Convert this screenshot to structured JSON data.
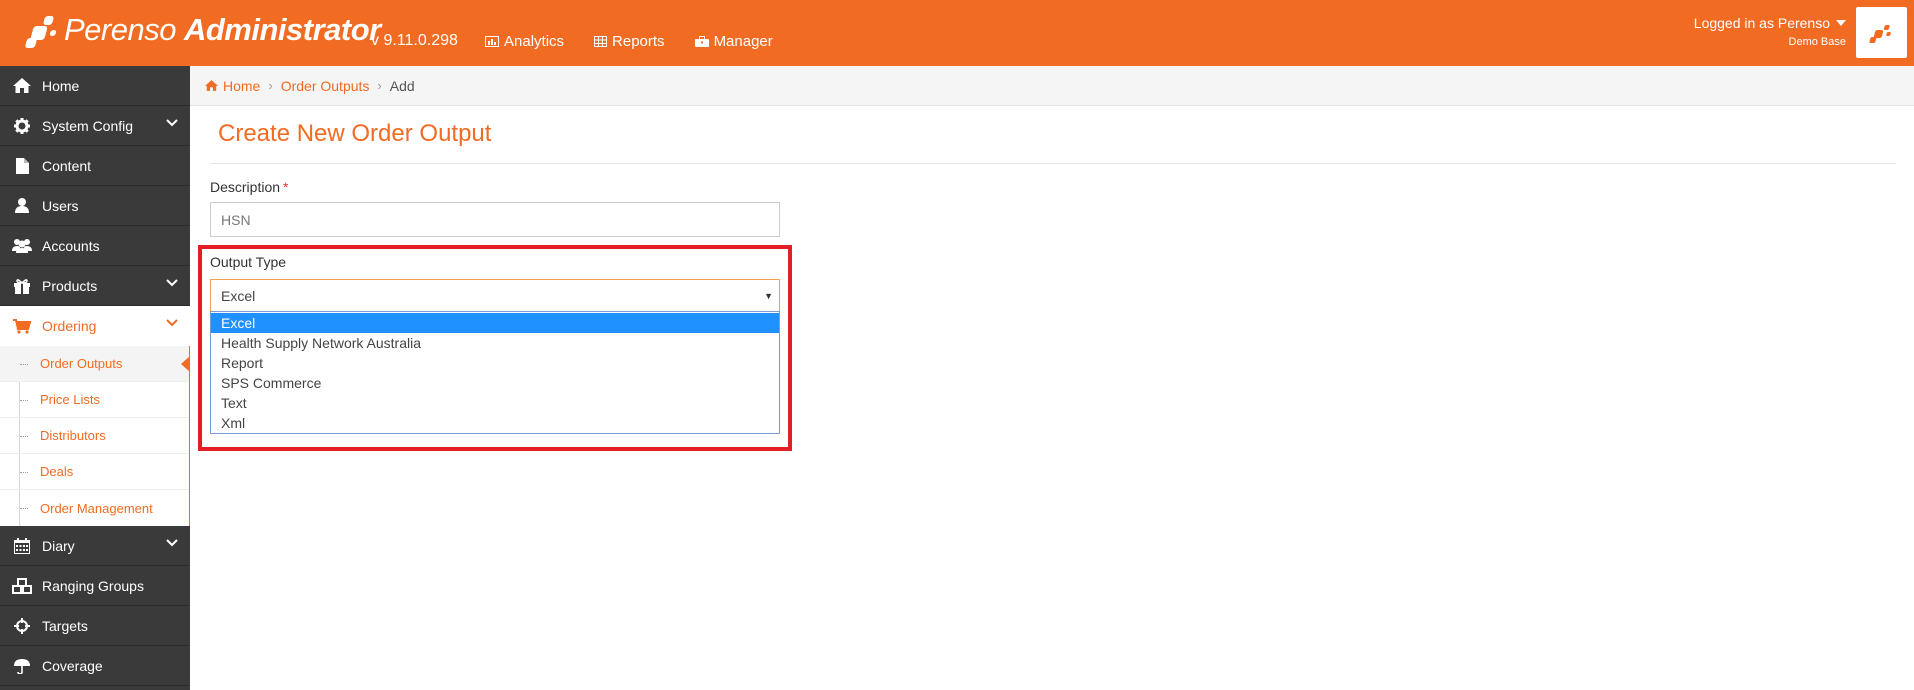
{
  "header": {
    "brand_light": "Perenso",
    "brand_bold": "Administrator",
    "version": "v 9.11.0.298",
    "nav": [
      {
        "label": "Analytics",
        "icon": "chart-icon"
      },
      {
        "label": "Reports",
        "icon": "table-icon"
      },
      {
        "label": "Manager",
        "icon": "briefcase-icon"
      }
    ],
    "user": {
      "logged_in": "Logged in as Perenso",
      "base": "Demo Base"
    },
    "accent_color": "#f26b22"
  },
  "sidebar": {
    "items": [
      {
        "label": "Home",
        "icon": "home-icon",
        "expandable": false
      },
      {
        "label": "System Config",
        "icon": "gear-icon",
        "expandable": true
      },
      {
        "label": "Content",
        "icon": "file-icon",
        "expandable": false
      },
      {
        "label": "Users",
        "icon": "user-icon",
        "expandable": false
      },
      {
        "label": "Accounts",
        "icon": "users-icon",
        "expandable": false
      },
      {
        "label": "Products",
        "icon": "gift-icon",
        "expandable": true
      },
      {
        "label": "Ordering",
        "icon": "cart-icon",
        "expandable": true,
        "active": true
      }
    ],
    "ordering_sub": [
      {
        "label": "Order Outputs",
        "current": true
      },
      {
        "label": "Price Lists"
      },
      {
        "label": "Distributors"
      },
      {
        "label": "Deals"
      },
      {
        "label": "Order Management"
      }
    ],
    "items_after": [
      {
        "label": "Diary",
        "icon": "calendar-icon",
        "expandable": true
      },
      {
        "label": "Ranging Groups",
        "icon": "cubes-icon",
        "expandable": false
      },
      {
        "label": "Targets",
        "icon": "crosshair-icon",
        "expandable": false
      },
      {
        "label": "Coverage",
        "icon": "umbrella-icon",
        "expandable": false
      }
    ]
  },
  "breadcrumb": {
    "home": "Home",
    "section": "Order Outputs",
    "current": "Add"
  },
  "form": {
    "title": "Create New Order Output",
    "description_label": "Description",
    "required_mark": "*",
    "description_value": "HSN",
    "output_type_label": "Output Type",
    "output_type_value": "Excel",
    "output_type_options": [
      "Excel",
      "Health Supply Network Australia",
      "Report",
      "SPS Commerce",
      "Text",
      "Xml"
    ]
  }
}
